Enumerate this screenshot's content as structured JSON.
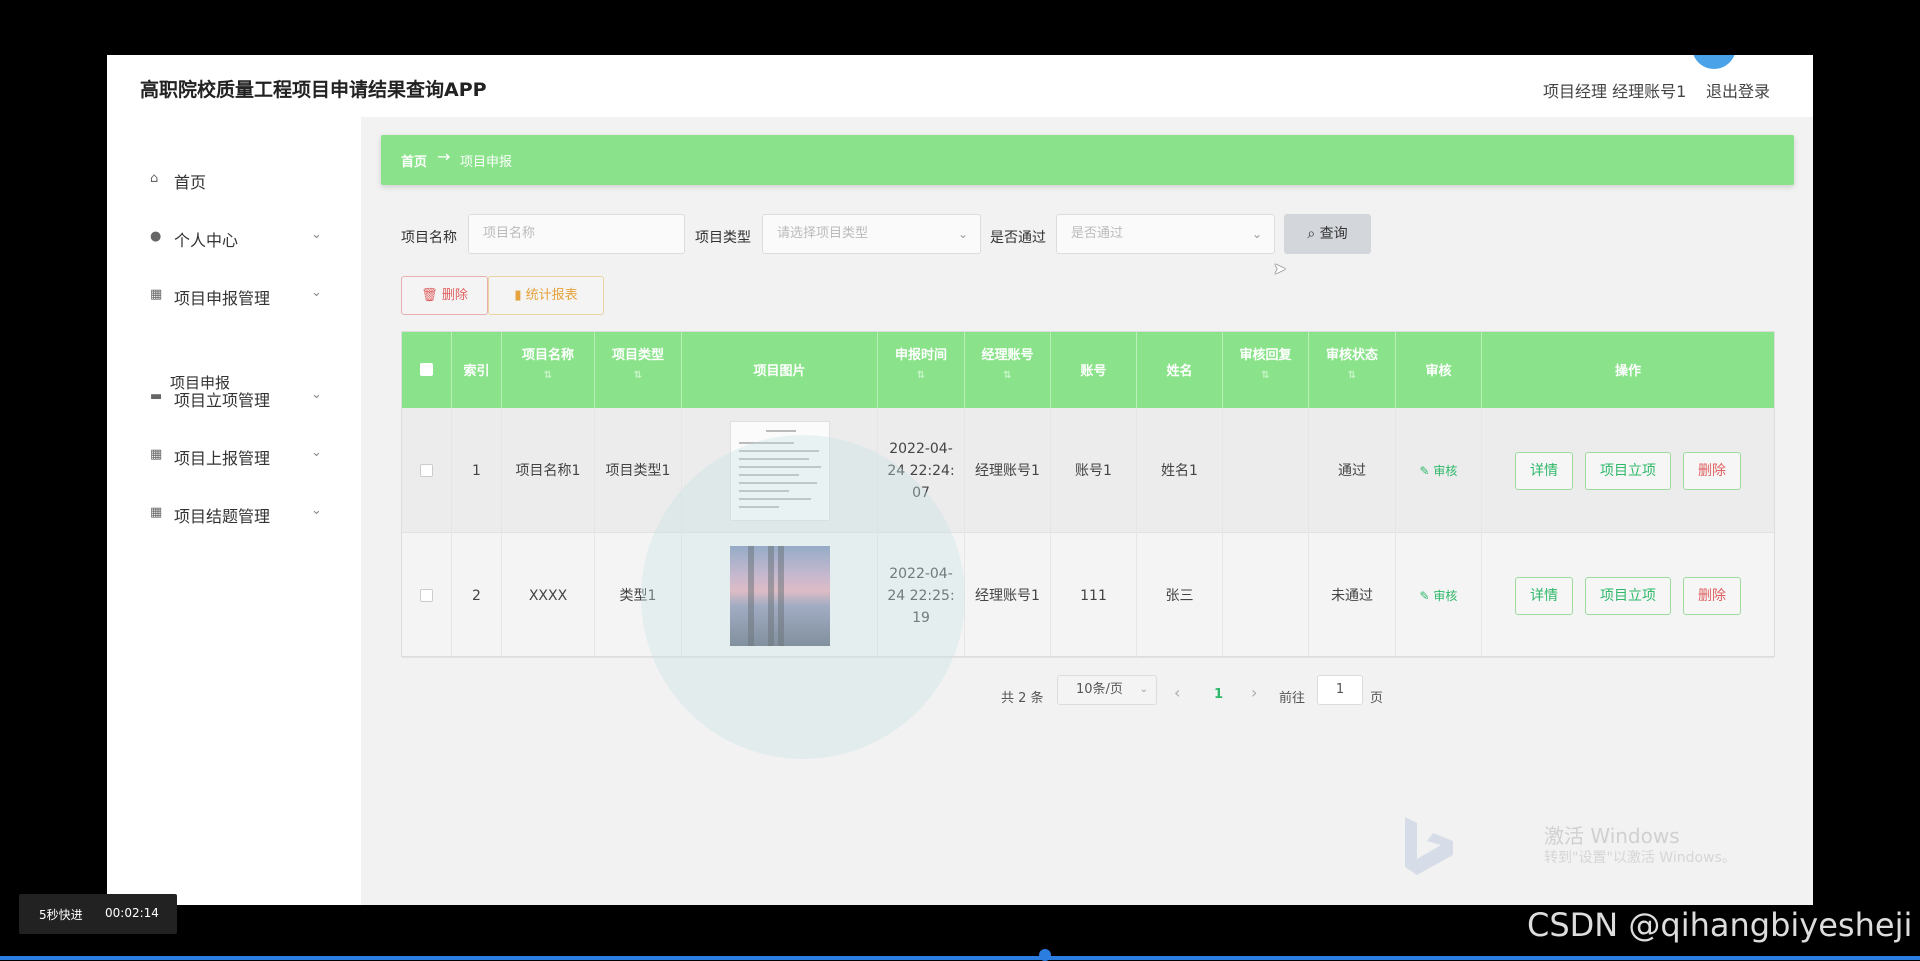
{
  "app": {
    "title": "高职院校质量工程项目申请结果查询APP",
    "user": "项目经理 经理账号1",
    "logout": "退出登录"
  },
  "sidebar": {
    "items": [
      {
        "label": "首页",
        "icon": "home-icon",
        "glyph": "⌂"
      },
      {
        "label": "个人中心",
        "icon": "user-icon",
        "glyph": "👤",
        "chevron": true
      },
      {
        "label": "项目申报管理",
        "icon": "grid-icon",
        "glyph": "▦",
        "chevron": true
      },
      {
        "label": "项目立项管理",
        "icon": "briefcase-icon",
        "glyph": "▬",
        "chevron": true
      },
      {
        "label": "项目上报管理",
        "icon": "grid-icon",
        "glyph": "▦",
        "chevron": true
      },
      {
        "label": "项目结题管理",
        "icon": "grid-icon",
        "glyph": "▦",
        "chevron": true
      }
    ],
    "subitem": "项目申报"
  },
  "breadcrumb": {
    "home": "首页",
    "arrow": "→",
    "current": "项目申报"
  },
  "filters": {
    "name_label": "项目名称",
    "name_placeholder": "项目名称",
    "type_label": "项目类型",
    "type_placeholder": "请选择项目类型",
    "pass_label": "是否通过",
    "pass_placeholder": "是否通过",
    "search": "查询"
  },
  "actions": {
    "delete": "删除",
    "report": "统计报表"
  },
  "table": {
    "headers": [
      "索引",
      "项目名称",
      "项目类型",
      "项目图片",
      "申报时间",
      "经理账号",
      "账号",
      "姓名",
      "审核回复",
      "审核状态",
      "审核",
      "操作"
    ],
    "rows": [
      {
        "index": "1",
        "name": "项目名称1",
        "type": "项目类型1",
        "time1": "2022-04-",
        "time2": "24 22:24:",
        "time3": "07",
        "manager": "经理账号1",
        "account": "账号1",
        "person": "姓名1",
        "reply": "",
        "status": "通过",
        "audit": "审核"
      },
      {
        "index": "2",
        "name": "XXXX",
        "type": "类型1",
        "time1": "2022-04-",
        "time2": "24 22:25:",
        "time3": "19",
        "manager": "经理账号1",
        "account": "111",
        "person": "张三",
        "reply": "",
        "status": "未通过",
        "audit": "审核"
      }
    ],
    "ops": {
      "detail": "详情",
      "approve": "项目立项",
      "delete": "删除"
    }
  },
  "pagination": {
    "total": "共 2 条",
    "page_size": "10条/页",
    "prev": "‹",
    "current": "1",
    "next": "›",
    "goto": "前往",
    "goto_value": "1",
    "page_unit": "页"
  },
  "watermark": {
    "line1": "激活 Windows",
    "line2": "转到\"设置\"以激活 Windows。"
  },
  "video": {
    "speed": "5秒快进",
    "time": "00:02:14",
    "credit": "CSDN @qihangbiyesheji"
  },
  "colors": {
    "accent_green": "#8ae38a",
    "danger": "#e06060",
    "warning": "#e6a23c",
    "success": "#2fb86a",
    "progress": "#2b7de0"
  }
}
